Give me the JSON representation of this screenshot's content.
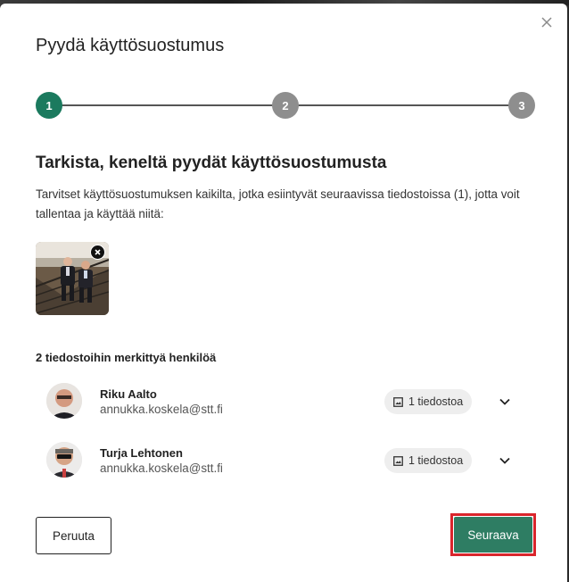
{
  "dialog": {
    "title": "Pyydä käyttösuostumus",
    "close_icon": "close-icon"
  },
  "stepper": {
    "steps": [
      {
        "label": "1",
        "state": "active"
      },
      {
        "label": "2",
        "state": "inactive"
      },
      {
        "label": "3",
        "state": "inactive"
      }
    ],
    "active_color": "#1b7a5e",
    "inactive_color": "#8e8e8e"
  },
  "content": {
    "heading": "Tarkista, keneltä pyydät käyttösuostumusta",
    "description": "Tarvitset käyttösuostumuksen kaikilta, jotka esiintyvät seuraavissa tiedostoissa (1), jotta voit tallentaa ja käyttää niitä:"
  },
  "files": {
    "thumbnails": [
      {
        "icon": "photo-thumbnail",
        "remove_icon": "remove-icon"
      }
    ]
  },
  "people": {
    "heading": "2 tiedostoihin merkittyä henkilöä",
    "items": [
      {
        "name": "Riku Aalto",
        "email": "annukka.koskela@stt.fi",
        "files_label": "1 tiedostoa"
      },
      {
        "name": "Turja Lehtonen",
        "email": "annukka.koskela@stt.fi",
        "files_label": "1 tiedostoa"
      }
    ]
  },
  "actions": {
    "cancel_label": "Peruuta",
    "next_label": "Seuraava",
    "next_color": "#2e7d63",
    "highlight_color": "#d9252c"
  }
}
